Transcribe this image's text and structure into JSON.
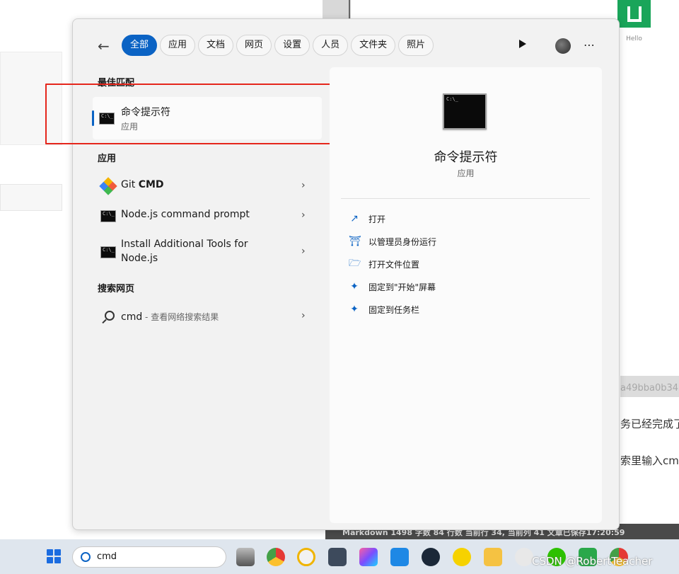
{
  "background": {
    "logo_caption": "Hello",
    "gray_text": "a49bba0b34",
    "line1": "务已经完成了",
    "line2": "索里输入cmd",
    "status_bar": "Markdown  1498 字数  84 行数  当前行 34, 当前列 41  文章已保存17:20:59"
  },
  "tabs": [
    "全部",
    "应用",
    "文档",
    "网页",
    "设置",
    "人员",
    "文件夹",
    "照片"
  ],
  "sections": {
    "best_match": "最佳匹配",
    "apps": "应用",
    "web": "搜索网页"
  },
  "best": {
    "title": "命令提示符",
    "sub": "应用"
  },
  "apps": [
    {
      "prefix": "Git ",
      "bold": "CMD"
    },
    {
      "title": "Node.js command prompt"
    },
    {
      "title_line1": "Install Additional Tools for",
      "title_line2": "Node.js"
    }
  ],
  "web": {
    "query": "cmd",
    "suffix": " - 查看网络搜索结果"
  },
  "detail": {
    "title": "命令提示符",
    "sub": "应用",
    "actions": [
      "打开",
      "以管理员身份运行",
      "打开文件位置",
      "固定到\"开始\"屏幕",
      "固定到任务栏"
    ]
  },
  "taskbar": {
    "search_value": "cmd",
    "watermark": "CSDN @RobertTeacher"
  },
  "colors": {
    "accent": "#0b63c4",
    "highlight": "#e5261c"
  }
}
